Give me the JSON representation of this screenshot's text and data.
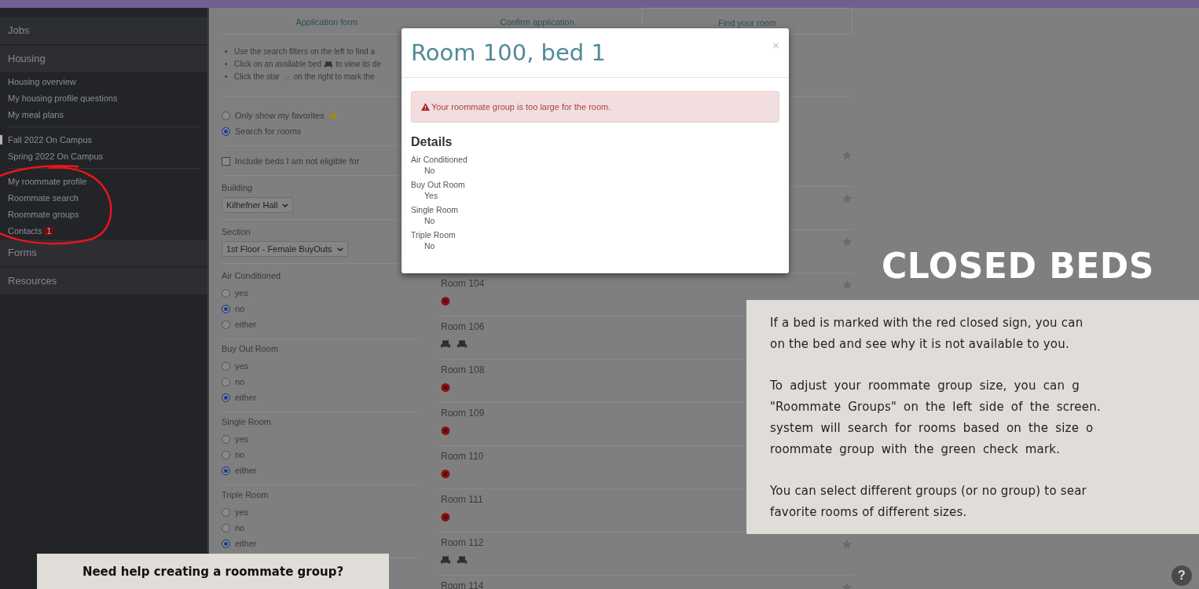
{
  "sidebar": {
    "items": [
      {
        "kind": "header",
        "label": "Jobs",
        "selected": false
      },
      {
        "kind": "header",
        "label": "Housing",
        "selected": false
      },
      {
        "kind": "link",
        "label": "Housing overview",
        "selected": false
      },
      {
        "kind": "link",
        "label": "My housing profile questions",
        "selected": false
      },
      {
        "kind": "link",
        "label": "My meal plans",
        "selected": false
      },
      {
        "kind": "divider"
      },
      {
        "kind": "link",
        "label": "Fall 2022 On Campus",
        "selected": true
      },
      {
        "kind": "link",
        "label": "Spring 2022 On Campus",
        "selected": false
      },
      {
        "kind": "divider"
      },
      {
        "kind": "link",
        "label": "My roommate profile",
        "selected": false
      },
      {
        "kind": "link",
        "label": "Roommate search",
        "selected": false
      },
      {
        "kind": "link",
        "label": "Roommate groups",
        "selected": false
      },
      {
        "kind": "link",
        "label": "Contacts",
        "badge": "1",
        "selected": false
      },
      {
        "kind": "header",
        "label": "Forms",
        "selected": false
      },
      {
        "kind": "header",
        "label": "Resources",
        "selected": false
      }
    ]
  },
  "tabs": [
    {
      "label": "Application form",
      "selected": false
    },
    {
      "label": "Confirm application",
      "selected": false
    },
    {
      "label": "Find your room",
      "selected": true
    }
  ],
  "instructions": [
    {
      "marker": "•",
      "before": "Use the search filters on the left to find a"
    },
    {
      "marker": "•",
      "before": "Click on an available bed",
      "after": "to view its de"
    },
    {
      "marker": "•",
      "before": "Click the star",
      "after": "on the right to mark the"
    }
  ],
  "view_options": [
    {
      "kind": "favorites",
      "label": "Only show my favorites",
      "selected": false
    },
    {
      "kind": "search",
      "label": "Search for rooms",
      "selected": true
    }
  ],
  "ineligible_checkbox": {
    "label": "Include beds I am not eligible for",
    "checked": false
  },
  "selects": [
    {
      "label": "Building",
      "value": "Kilhefner Hall"
    },
    {
      "label": "Section",
      "value": "1st Floor - Female BuyOuts"
    }
  ],
  "filters": [
    {
      "label": "Air Conditioned",
      "options": [
        {
          "label": "yes",
          "selected": false
        },
        {
          "label": "no",
          "selected": true
        },
        {
          "label": "either",
          "selected": false
        }
      ]
    },
    {
      "label": "Buy Out Room",
      "options": [
        {
          "label": "yes",
          "selected": false
        },
        {
          "label": "no",
          "selected": false
        },
        {
          "label": "either",
          "selected": true
        }
      ]
    },
    {
      "label": "Single Room",
      "options": [
        {
          "label": "yes",
          "selected": false
        },
        {
          "label": "no",
          "selected": false
        },
        {
          "label": "either",
          "selected": true
        }
      ]
    },
    {
      "label": "Triple Room",
      "options": [
        {
          "label": "yes",
          "selected": false
        },
        {
          "label": "no",
          "selected": false
        },
        {
          "label": "either",
          "selected": true
        }
      ]
    }
  ],
  "rooms": [
    {
      "kind": "covered"
    },
    {
      "kind": "covered"
    },
    {
      "kind": "covered"
    },
    {
      "kind": "room",
      "name": "Room 104",
      "beds": [
        {
          "kind": "closed"
        }
      ]
    },
    {
      "kind": "room",
      "name": "Room 106",
      "beds": [
        {
          "kind": "open"
        },
        {
          "kind": "open"
        }
      ]
    },
    {
      "kind": "room",
      "name": "Room 108",
      "beds": [
        {
          "kind": "closed"
        }
      ]
    },
    {
      "kind": "room",
      "name": "Room 109",
      "beds": [
        {
          "kind": "closed"
        }
      ]
    },
    {
      "kind": "room",
      "name": "Room 110",
      "beds": [
        {
          "kind": "closed"
        }
      ]
    },
    {
      "kind": "room",
      "name": "Room 111",
      "beds": [
        {
          "kind": "closed"
        }
      ]
    },
    {
      "kind": "room",
      "name": "Room 112",
      "beds": [
        {
          "kind": "open"
        },
        {
          "kind": "open"
        }
      ]
    },
    {
      "kind": "room",
      "name": "Room 114"
    }
  ],
  "modal": {
    "title": "Room 100, bed 1",
    "close": "×",
    "alert": "Your roommate group is too large for the room.",
    "details_heading": "Details",
    "details": [
      {
        "label": "Air Conditioned",
        "value": "No"
      },
      {
        "label": "Buy Out Room",
        "value": "Yes"
      },
      {
        "label": "Single Room",
        "value": "No"
      },
      {
        "label": "Triple Room",
        "value": "No"
      }
    ]
  },
  "tutorial": {
    "title": "CLOSED BEDS",
    "paragraphs": [
      [
        "If a bed is marked with the red closed sign, you can",
        "on the bed and see why it is not available to you."
      ],
      [
        "To adjust your roommate group size, you can g",
        "\"Roommate Groups\" on the left side of the screen.",
        "system will search for rooms based on the size o",
        "roommate group with the green check mark."
      ],
      [
        "You can select different groups (or no group) to sear",
        "favorite rooms of different sizes."
      ]
    ],
    "help_banner": "Need help creating a roommate group?",
    "help_button": "?"
  }
}
